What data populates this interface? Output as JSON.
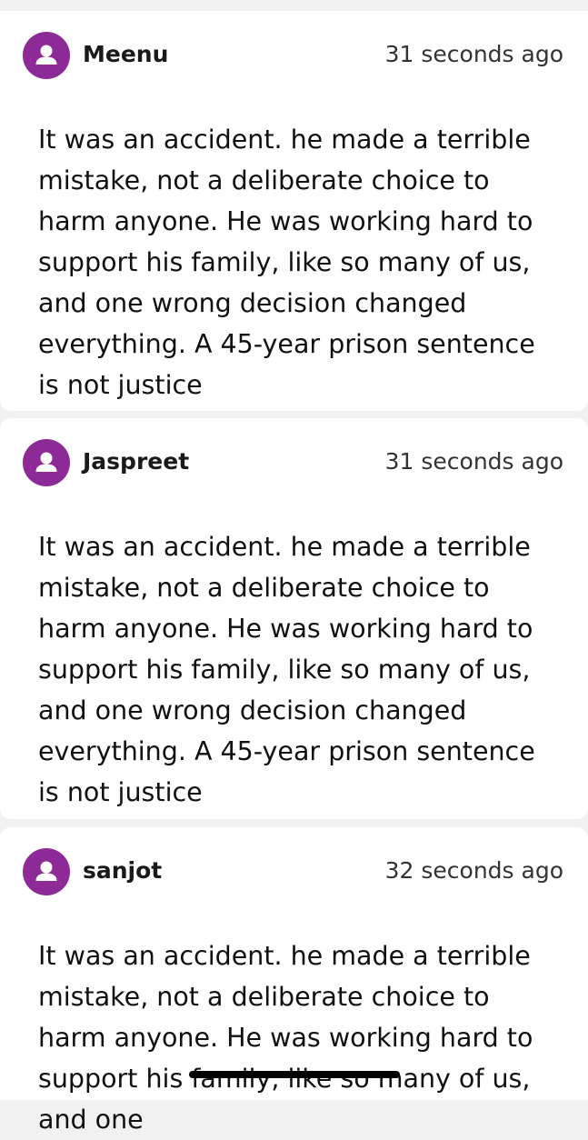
{
  "comments": [
    {
      "username": "Meenu",
      "timestamp": "31 seconds ago",
      "text": "It was an accident. he made a terrible mistake, not a deliberate choice to harm anyone. He was working hard to support his family, like so many of us, and one wrong decision changed everything. A 45-year prison sentence is not justice",
      "avatar_icon": "user-silhouette-icon",
      "avatar_color": "#8e2a97"
    },
    {
      "username": "Jaspreet",
      "timestamp": "31 seconds ago",
      "text": "It was an accident. he made a terrible mistake, not a deliberate choice to harm anyone. He was working hard to support his family, like so many of us, and one wrong decision changed everything. A 45-year prison sentence is not justice",
      "avatar_icon": "user-silhouette-icon",
      "avatar_color": "#8e2a97"
    },
    {
      "username": "sanjot",
      "timestamp": "32 seconds ago",
      "text": "It was an accident. he made a terrible mistake, not a deliberate choice to harm anyone. He was working hard to support his family, like so many of us, and one",
      "avatar_icon": "user-silhouette-icon",
      "avatar_color": "#8e2a97"
    }
  ]
}
